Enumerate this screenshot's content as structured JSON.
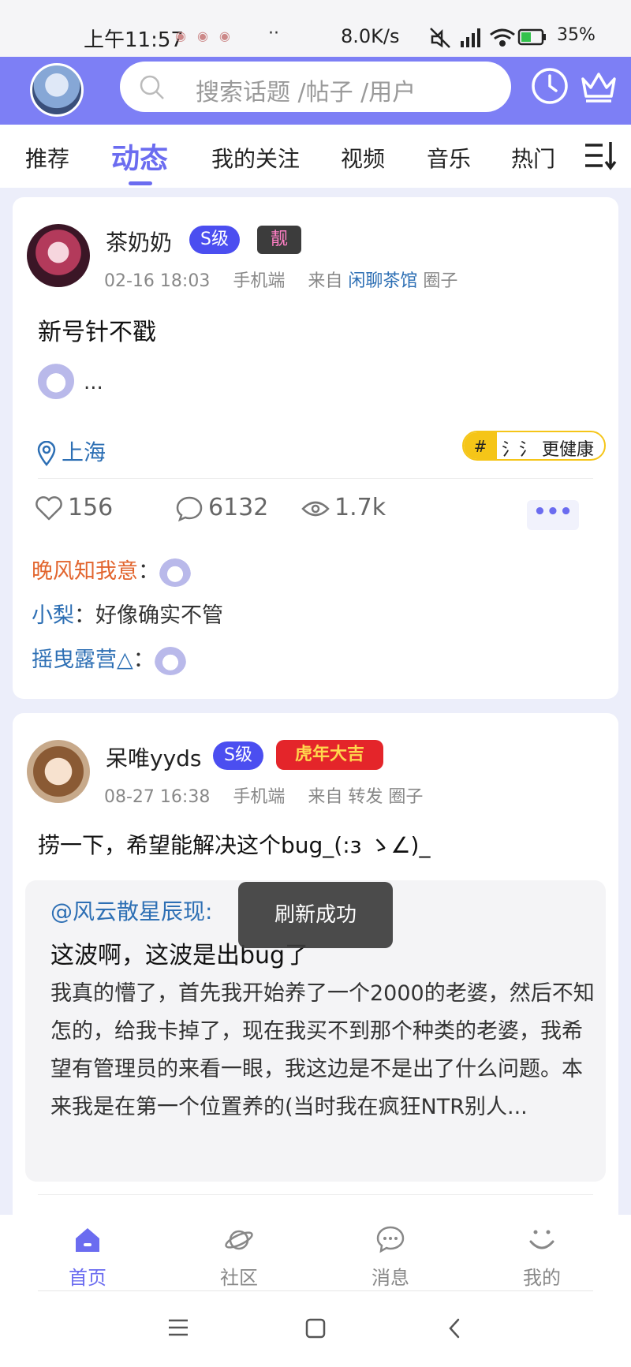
{
  "statusbar": {
    "time": "上午11:57",
    "notification_icons": [
      "app-icon",
      "app-icon",
      "app-icon"
    ],
    "more_dots": "··",
    "net_speed": "8.0K/s",
    "battery": "35%"
  },
  "header": {
    "search_placeholder": "搜索话题 /帖子 /用户",
    "icons": [
      "clock-icon",
      "crown-icon"
    ]
  },
  "tabs": [
    {
      "label": "推荐"
    },
    {
      "label": "动态",
      "active": true
    },
    {
      "label": "我的关注"
    },
    {
      "label": "视频"
    },
    {
      "label": "音乐"
    },
    {
      "label": "热门"
    }
  ],
  "posts": [
    {
      "username": "茶奶奶",
      "level": "S级",
      "extra_badge": "靓",
      "time": "02-16 18:03",
      "device": "手机端",
      "from_label": "来自",
      "circle": "闲聊茶馆",
      "circle_suffix": "圈子",
      "content": "新号针不戳",
      "sticker_ellipsis": "...",
      "location": "上海",
      "tag_hash": "#",
      "tag_text": "氵氵 更健康",
      "likes": "156",
      "comments_count": "6132",
      "views": "1.7k",
      "more": "•••",
      "comments": [
        {
          "author": "晚风知我意",
          "sep": "：",
          "text": "",
          "sticker": true
        },
        {
          "author": "小梨",
          "sep": "：",
          "text": "好像确实不管",
          "sticker": false
        },
        {
          "author": "摇曳露营△",
          "sep": "：",
          "text": "",
          "sticker": true
        }
      ]
    },
    {
      "username": "呆唯yyds",
      "level": "S级",
      "extra_badge": "虎年大吉",
      "time": "08-27 16:38",
      "device": "手机端",
      "from_label": "来自",
      "circle": "转发",
      "circle_suffix": "圈子",
      "content": "捞一下，希望能解决这个bug_(:з ゝ∠)_",
      "quote": {
        "author": "@风云散星辰现:",
        "title": "这波啊，这波是出bug了",
        "body": "我真的懵了，首先我开始养了一个2000的老婆，然后不知怎的，给我卡掉了，现在我买不到那个种类的老婆，我希望有管理员的来看一眼，我这边是不是出了什么问题。本来我是在第一个位置养的(当时我在疯狂NTR别人..."
      }
    }
  ],
  "toast": "刷新成功",
  "bottom_nav": [
    {
      "label": "首页",
      "icon": "home-icon",
      "active": true
    },
    {
      "label": "社区",
      "icon": "planet-icon"
    },
    {
      "label": "消息",
      "icon": "chat-icon"
    },
    {
      "label": "我的",
      "icon": "smile-icon"
    }
  ],
  "colors": {
    "accent": "#6b6cf0",
    "header_bg": "#7d7ff5",
    "link": "#2d6fb4",
    "comment_name_orange": "#e2652e",
    "level_badge": "#4b4ef0",
    "tag_yellow": "#f5c518"
  }
}
